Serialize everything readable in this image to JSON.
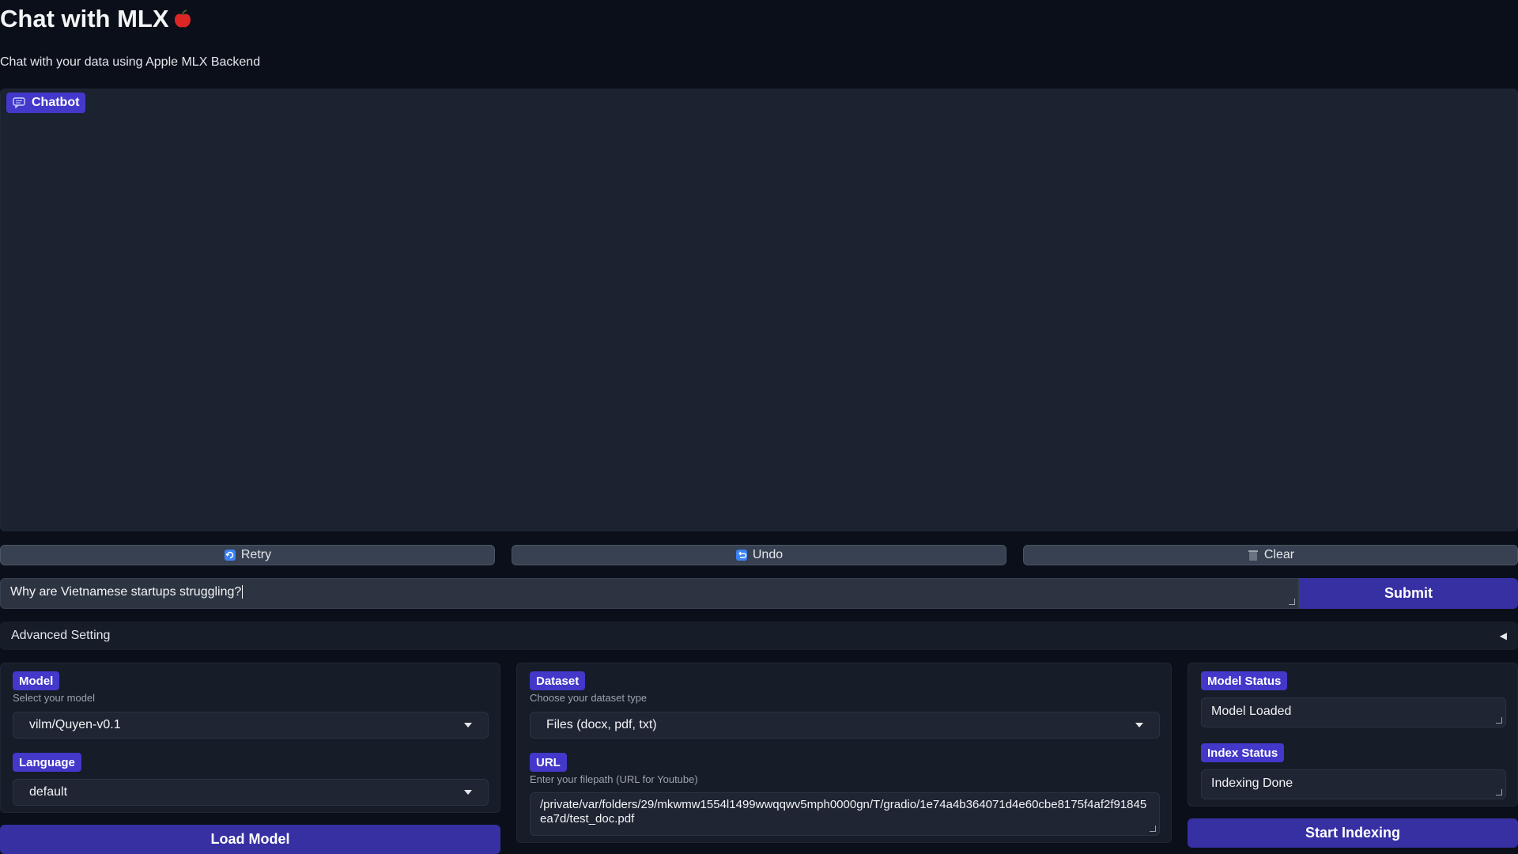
{
  "app": {
    "title": "Chat with MLX",
    "subtitle": "Chat with your data using Apple MLX Backend"
  },
  "chatbot": {
    "label": "Chatbot"
  },
  "actions": {
    "retry": "Retry",
    "undo": "Undo",
    "clear": "Clear"
  },
  "input": {
    "value": "Why are Vietnamese startups struggling?",
    "submit": "Submit"
  },
  "advanced": {
    "label": "Advanced Setting",
    "toggle_icon": "◀"
  },
  "model": {
    "label": "Model",
    "hint": "Select your model",
    "selected": "vilm/Quyen-v0.1",
    "language_label": "Language",
    "language_selected": "default",
    "load_button": "Load Model"
  },
  "dataset": {
    "label": "Dataset",
    "hint": "Choose your dataset type",
    "selected": "Files (docx, pdf, txt)",
    "url_label": "URL",
    "url_hint": "Enter your filepath (URL for Youtube)",
    "url_value": "/private/var/folders/29/mkwmw1554l1499wwqqwv5mph0000gn/T/gradio/1e74a4b364071d4e60cbe8175f4af2f91845ea7d/test_doc.pdf"
  },
  "status": {
    "model_label": "Model Status",
    "model_value": "Model Loaded",
    "index_label": "Index Status",
    "index_value": "Indexing Done",
    "start_button": "Start Indexing"
  },
  "colors": {
    "accent": "#4338ca",
    "background": "#0b0f19",
    "panel": "#161c28"
  }
}
